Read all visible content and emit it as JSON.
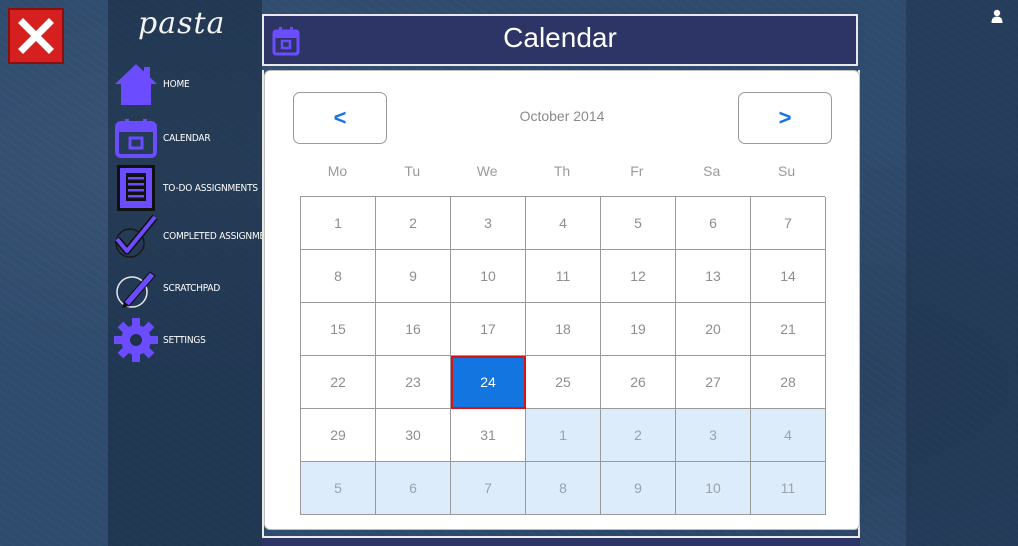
{
  "app": {
    "logo": "pasta"
  },
  "sidebar": {
    "items": [
      {
        "label": "Home",
        "icon": "home-icon"
      },
      {
        "label": "Calendar",
        "icon": "calendar-icon"
      },
      {
        "label": "To-Do Assignments",
        "icon": "clipboard-icon"
      },
      {
        "label": "Completed Assignments",
        "icon": "checkmark-icon"
      },
      {
        "label": "Scratchpad",
        "icon": "pen-icon"
      },
      {
        "label": "Settings",
        "icon": "gear-icon"
      }
    ]
  },
  "header": {
    "title": "Calendar"
  },
  "calendar": {
    "month_label": "October 2014",
    "prev_label": "<",
    "next_label": ">",
    "weekdays": [
      "Mo",
      "Tu",
      "We",
      "Th",
      "Fr",
      "Sa",
      "Su"
    ],
    "today": "24",
    "weeks": [
      [
        {
          "d": "1"
        },
        {
          "d": "2"
        },
        {
          "d": "3"
        },
        {
          "d": "4"
        },
        {
          "d": "5"
        },
        {
          "d": "6"
        },
        {
          "d": "7"
        }
      ],
      [
        {
          "d": "8"
        },
        {
          "d": "9"
        },
        {
          "d": "10"
        },
        {
          "d": "11"
        },
        {
          "d": "12"
        },
        {
          "d": "13"
        },
        {
          "d": "14"
        }
      ],
      [
        {
          "d": "15"
        },
        {
          "d": "16"
        },
        {
          "d": "17"
        },
        {
          "d": "18"
        },
        {
          "d": "19"
        },
        {
          "d": "20"
        },
        {
          "d": "21"
        }
      ],
      [
        {
          "d": "22"
        },
        {
          "d": "23"
        },
        {
          "d": "24",
          "today": true
        },
        {
          "d": "25"
        },
        {
          "d": "26"
        },
        {
          "d": "27"
        },
        {
          "d": "28"
        }
      ],
      [
        {
          "d": "29"
        },
        {
          "d": "30"
        },
        {
          "d": "31"
        },
        {
          "d": "1",
          "next": true
        },
        {
          "d": "2",
          "next": true
        },
        {
          "d": "3",
          "next": true
        },
        {
          "d": "4",
          "next": true
        }
      ],
      [
        {
          "d": "5",
          "next": true
        },
        {
          "d": "6",
          "next": true
        },
        {
          "d": "7",
          "next": true
        },
        {
          "d": "8",
          "next": true
        },
        {
          "d": "9",
          "next": true
        },
        {
          "d": "10",
          "next": true
        },
        {
          "d": "11",
          "next": true
        }
      ]
    ]
  },
  "colors": {
    "accent": "#6b4cff",
    "header_bg": "#2c3566",
    "today_bg": "#1275e0",
    "next_month_bg": "#ddecfb",
    "close_bg": "#d62020"
  }
}
